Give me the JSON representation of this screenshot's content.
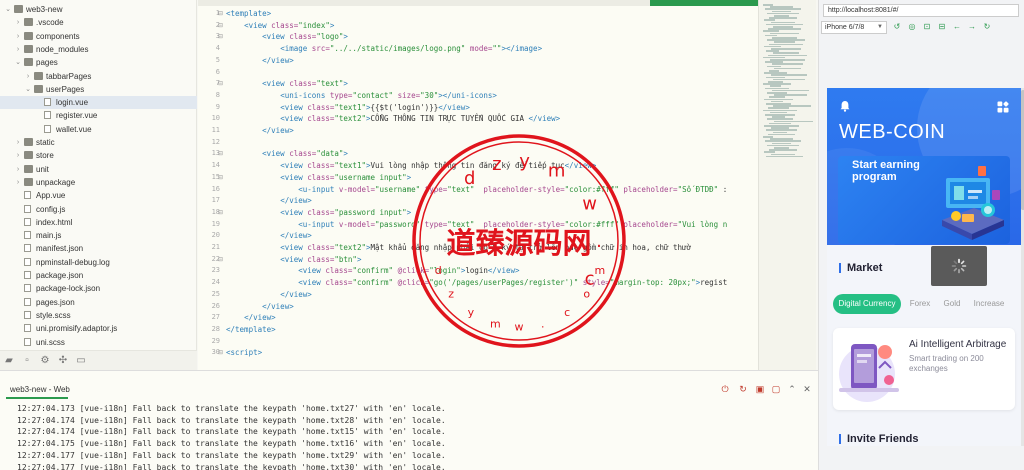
{
  "sidebar": {
    "items": [
      {
        "label": "web3-new",
        "depth": 0,
        "type": "folder",
        "open": true
      },
      {
        "label": ".vscode",
        "depth": 1,
        "type": "folder",
        "open": false
      },
      {
        "label": "components",
        "depth": 1,
        "type": "folder",
        "open": false
      },
      {
        "label": "node_modules",
        "depth": 1,
        "type": "folder",
        "open": false
      },
      {
        "label": "pages",
        "depth": 1,
        "type": "folder",
        "open": true
      },
      {
        "label": "tabbarPages",
        "depth": 2,
        "type": "folder",
        "open": false
      },
      {
        "label": "userPages",
        "depth": 2,
        "type": "folder",
        "open": true
      },
      {
        "label": "login.vue",
        "depth": 3,
        "type": "file",
        "selected": true
      },
      {
        "label": "register.vue",
        "depth": 3,
        "type": "file"
      },
      {
        "label": "wallet.vue",
        "depth": 3,
        "type": "file"
      },
      {
        "label": "static",
        "depth": 1,
        "type": "folder",
        "open": false
      },
      {
        "label": "store",
        "depth": 1,
        "type": "folder",
        "open": false
      },
      {
        "label": "unit",
        "depth": 1,
        "type": "folder",
        "open": false
      },
      {
        "label": "unpackage",
        "depth": 1,
        "type": "folder",
        "open": false
      },
      {
        "label": "App.vue",
        "depth": 1,
        "type": "file"
      },
      {
        "label": "config.js",
        "depth": 1,
        "type": "file"
      },
      {
        "label": "index.html",
        "depth": 1,
        "type": "file"
      },
      {
        "label": "main.js",
        "depth": 1,
        "type": "file"
      },
      {
        "label": "manifest.json",
        "depth": 1,
        "type": "file"
      },
      {
        "label": "npminstall-debug.log",
        "depth": 1,
        "type": "file"
      },
      {
        "label": "package.json",
        "depth": 1,
        "type": "file"
      },
      {
        "label": "package-lock.json",
        "depth": 1,
        "type": "file"
      },
      {
        "label": "pages.json",
        "depth": 1,
        "type": "file"
      },
      {
        "label": "style.scss",
        "depth": 1,
        "type": "file"
      },
      {
        "label": "uni.promisify.adaptor.js",
        "depth": 1,
        "type": "file"
      },
      {
        "label": "uni.scss",
        "depth": 1,
        "type": "file"
      }
    ],
    "toolbar_icons": [
      "folder-icon",
      "file-icon",
      "gear-icon",
      "puzzle-icon",
      "terminal-icon"
    ]
  },
  "editor": {
    "lines": [
      {
        "n": "1",
        "fold": true,
        "tokens": [
          [
            "t-tag",
            "<template>"
          ]
        ]
      },
      {
        "n": "2",
        "fold": true,
        "tokens": [
          [
            "t-txt",
            "    "
          ],
          [
            "t-tag",
            "<view "
          ],
          [
            "t-attr",
            "class="
          ],
          [
            "t-str",
            "\"index\""
          ],
          [
            "t-tag",
            ">"
          ]
        ]
      },
      {
        "n": "3",
        "fold": true,
        "tokens": [
          [
            "t-txt",
            "        "
          ],
          [
            "t-tag",
            "<view "
          ],
          [
            "t-attr",
            "class="
          ],
          [
            "t-str",
            "\"logo\""
          ],
          [
            "t-tag",
            ">"
          ]
        ]
      },
      {
        "n": "4",
        "tokens": [
          [
            "t-txt",
            "            "
          ],
          [
            "t-tag",
            "<image "
          ],
          [
            "t-attr",
            "src="
          ],
          [
            "t-str",
            "\"../../static/images/logo.png\""
          ],
          [
            "t-attr",
            " mode="
          ],
          [
            "t-str",
            "\"\""
          ],
          [
            "t-tag",
            "></image>"
          ]
        ]
      },
      {
        "n": "5",
        "tokens": [
          [
            "t-txt",
            "        "
          ],
          [
            "t-tag",
            "</view>"
          ]
        ]
      },
      {
        "n": "6",
        "tokens": []
      },
      {
        "n": "7",
        "fold": true,
        "tokens": [
          [
            "t-txt",
            "        "
          ],
          [
            "t-tag",
            "<view "
          ],
          [
            "t-attr",
            "class="
          ],
          [
            "t-str",
            "\"text\""
          ],
          [
            "t-tag",
            ">"
          ]
        ]
      },
      {
        "n": "8",
        "tokens": [
          [
            "t-txt",
            "            "
          ],
          [
            "t-tag",
            "<uni-icons "
          ],
          [
            "t-attr",
            "type="
          ],
          [
            "t-str",
            "\"contact\""
          ],
          [
            "t-attr",
            " size="
          ],
          [
            "t-str",
            "\"30\""
          ],
          [
            "t-tag",
            "></uni-icons>"
          ]
        ]
      },
      {
        "n": "9",
        "tokens": [
          [
            "t-txt",
            "            "
          ],
          [
            "t-tag",
            "<view "
          ],
          [
            "t-attr",
            "class="
          ],
          [
            "t-str",
            "\"text1\""
          ],
          [
            "t-tag",
            ">"
          ],
          [
            "t-txt",
            "{{$t('login')}}"
          ],
          [
            "t-tag",
            "</view>"
          ]
        ]
      },
      {
        "n": "10",
        "tokens": [
          [
            "t-txt",
            "            "
          ],
          [
            "t-tag",
            "<view "
          ],
          [
            "t-attr",
            "class="
          ],
          [
            "t-str",
            "\"text2\""
          ],
          [
            "t-tag",
            ">"
          ],
          [
            "t-txt",
            "CỔNG THÔNG TIN TRỰC TUYẾN QUỐC GIA "
          ],
          [
            "t-tag",
            "</view>"
          ]
        ]
      },
      {
        "n": "11",
        "tokens": [
          [
            "t-txt",
            "        "
          ],
          [
            "t-tag",
            "</view>"
          ]
        ]
      },
      {
        "n": "12",
        "tokens": []
      },
      {
        "n": "13",
        "fold": true,
        "tokens": [
          [
            "t-txt",
            "        "
          ],
          [
            "t-tag",
            "<view "
          ],
          [
            "t-attr",
            "class="
          ],
          [
            "t-str",
            "\"data\""
          ],
          [
            "t-tag",
            ">"
          ]
        ]
      },
      {
        "n": "14",
        "tokens": [
          [
            "t-txt",
            "            "
          ],
          [
            "t-tag",
            "<view "
          ],
          [
            "t-attr",
            "class="
          ],
          [
            "t-str",
            "\"text1\""
          ],
          [
            "t-tag",
            ">"
          ],
          [
            "t-txt",
            "Vui lòng nhập thông tin đăng ký để tiếp tục"
          ],
          [
            "t-tag",
            "</view>"
          ]
        ]
      },
      {
        "n": "15",
        "fold": true,
        "tokens": [
          [
            "t-txt",
            "            "
          ],
          [
            "t-tag",
            "<view "
          ],
          [
            "t-attr",
            "class="
          ],
          [
            "t-str",
            "\"username input\""
          ],
          [
            "t-tag",
            ">"
          ]
        ]
      },
      {
        "n": "16",
        "tokens": [
          [
            "t-txt",
            "                "
          ],
          [
            "t-tag",
            "<u-input "
          ],
          [
            "t-attr",
            "v-model="
          ],
          [
            "t-str",
            "\"username\""
          ],
          [
            "t-attr",
            " type="
          ],
          [
            "t-str",
            "\"text\""
          ],
          [
            "t-attr",
            "  placeholder-style="
          ],
          [
            "t-str",
            "\"color:#fff\""
          ],
          [
            "t-attr",
            " placeholder="
          ],
          [
            "t-str",
            "\"Số ĐTDĐ\""
          ],
          [
            "t-txt",
            " :"
          ]
        ]
      },
      {
        "n": "17",
        "tokens": [
          [
            "t-txt",
            "            "
          ],
          [
            "t-tag",
            "</view>"
          ]
        ]
      },
      {
        "n": "18",
        "fold": true,
        "tokens": [
          [
            "t-txt",
            "            "
          ],
          [
            "t-tag",
            "<view "
          ],
          [
            "t-attr",
            "class="
          ],
          [
            "t-str",
            "\"password input\""
          ],
          [
            "t-tag",
            ">"
          ]
        ]
      },
      {
        "n": "19",
        "tokens": [
          [
            "t-txt",
            "                "
          ],
          [
            "t-tag",
            "<u-input "
          ],
          [
            "t-attr",
            "v-model="
          ],
          [
            "t-str",
            "\"password\""
          ],
          [
            "t-attr",
            " type="
          ],
          [
            "t-str",
            "\"text\""
          ],
          [
            "t-attr",
            "  placeholder-style="
          ],
          [
            "t-str",
            "\"color:#fff\""
          ],
          [
            "t-attr",
            " placeholder="
          ],
          [
            "t-str",
            "\"Vui lòng n"
          ]
        ]
      },
      {
        "n": "20",
        "tokens": [
          [
            "t-txt",
            "            "
          ],
          [
            "t-tag",
            "</view>"
          ]
        ]
      },
      {
        "n": "21",
        "tokens": [
          [
            "t-txt",
            "            "
          ],
          [
            "t-tag",
            "<view "
          ],
          [
            "t-attr",
            "class="
          ],
          [
            "t-str",
            "\"text2\""
          ],
          [
            "t-tag",
            ">"
          ],
          [
            "t-txt",
            "Mật khẩu đăng nhập phải có 8 ký tự trở lên bao gồm chữ in hoa, chữ thườ"
          ]
        ]
      },
      {
        "n": "22",
        "fold": true,
        "tokens": [
          [
            "t-txt",
            "            "
          ],
          [
            "t-tag",
            "<view "
          ],
          [
            "t-attr",
            "class="
          ],
          [
            "t-str",
            "\"btn\""
          ],
          [
            "t-tag",
            ">"
          ]
        ]
      },
      {
        "n": "23",
        "tokens": [
          [
            "t-txt",
            "                "
          ],
          [
            "t-tag",
            "<view "
          ],
          [
            "t-attr",
            "class="
          ],
          [
            "t-str",
            "\"confirm\""
          ],
          [
            "t-attr",
            " @click="
          ],
          [
            "t-str",
            "\"login\""
          ],
          [
            "t-tag",
            ">"
          ],
          [
            "t-txt",
            "login"
          ],
          [
            "t-tag",
            "</view>"
          ]
        ]
      },
      {
        "n": "24",
        "tokens": [
          [
            "t-txt",
            "                "
          ],
          [
            "t-tag",
            "<view "
          ],
          [
            "t-attr",
            "class="
          ],
          [
            "t-str",
            "\"confirm\""
          ],
          [
            "t-attr",
            " @click="
          ],
          [
            "t-str",
            "\"go('/pages/userPages/register')\""
          ],
          [
            "t-attr",
            " style="
          ],
          [
            "t-str",
            "\"margin-top: 20px;\""
          ],
          [
            "t-tag",
            ">"
          ],
          [
            "t-txt",
            "regist"
          ]
        ]
      },
      {
        "n": "25",
        "tokens": [
          [
            "t-txt",
            "            "
          ],
          [
            "t-tag",
            "</view>"
          ]
        ]
      },
      {
        "n": "26",
        "tokens": [
          [
            "t-txt",
            "        "
          ],
          [
            "t-tag",
            "</view>"
          ]
        ]
      },
      {
        "n": "27",
        "tokens": [
          [
            "t-txt",
            "    "
          ],
          [
            "t-tag",
            "</view>"
          ]
        ]
      },
      {
        "n": "28",
        "tokens": [
          [
            "t-tag",
            "</template>"
          ]
        ]
      },
      {
        "n": "29",
        "tokens": []
      },
      {
        "n": "30",
        "fold": true,
        "tokens": [
          [
            "t-tag",
            "<script>"
          ]
        ]
      }
    ]
  },
  "console": {
    "title": "web3-new - Web",
    "logs": [
      "12:27:04.173 [vue-i18n] Fall back to translate the keypath 'home.txt27' with 'en' locale.",
      "12:27:04.174 [vue-i18n] Fall back to translate the keypath 'home.txt28' with 'en' locale.",
      "12:27:04.174 [vue-i18n] Fall back to translate the keypath 'home.txt15' with 'en' locale.",
      "12:27:04.175 [vue-i18n] Fall back to translate the keypath 'home.txt16' with 'en' locale.",
      "12:27:04.177 [vue-i18n] Fall back to translate the keypath 'home.txt29' with 'en' locale.",
      "12:27:04.177 [vue-i18n] Fall back to translate the keypath 'home.txt30' with 'en' locale."
    ],
    "controls": [
      "stop-icon",
      "refresh-icon",
      "clear-icon",
      "square-icon",
      "collapse-icon",
      "close-icon"
    ]
  },
  "preview": {
    "url": "http://localhost:8081/#/",
    "device": "iPhone 6/7/8",
    "toolbar_icons": [
      "rotate-icon",
      "target-icon",
      "screenshot-icon",
      "inspect-icon",
      "back-icon",
      "forward-icon",
      "refresh-icon"
    ],
    "app": {
      "title": "WEB-COIN",
      "banner_text": "Start earning program",
      "market_title": "Market",
      "tabs": [
        "Digital Currency",
        "Forex",
        "Gold",
        "Increase"
      ],
      "card_title": "Ai Intelligent Arbitrage",
      "card_desc": "Smart trading on 200 exchanges",
      "invite_title": "Invite Friends"
    }
  },
  "watermark": {
    "text": "道臻源码网",
    "ring_text": "dzymw.com"
  },
  "colors": {
    "accent": "#2b9a4e",
    "app_blue": "#2f7bf0",
    "tab_active": "#25bf84",
    "watermark": "#e0141c"
  }
}
